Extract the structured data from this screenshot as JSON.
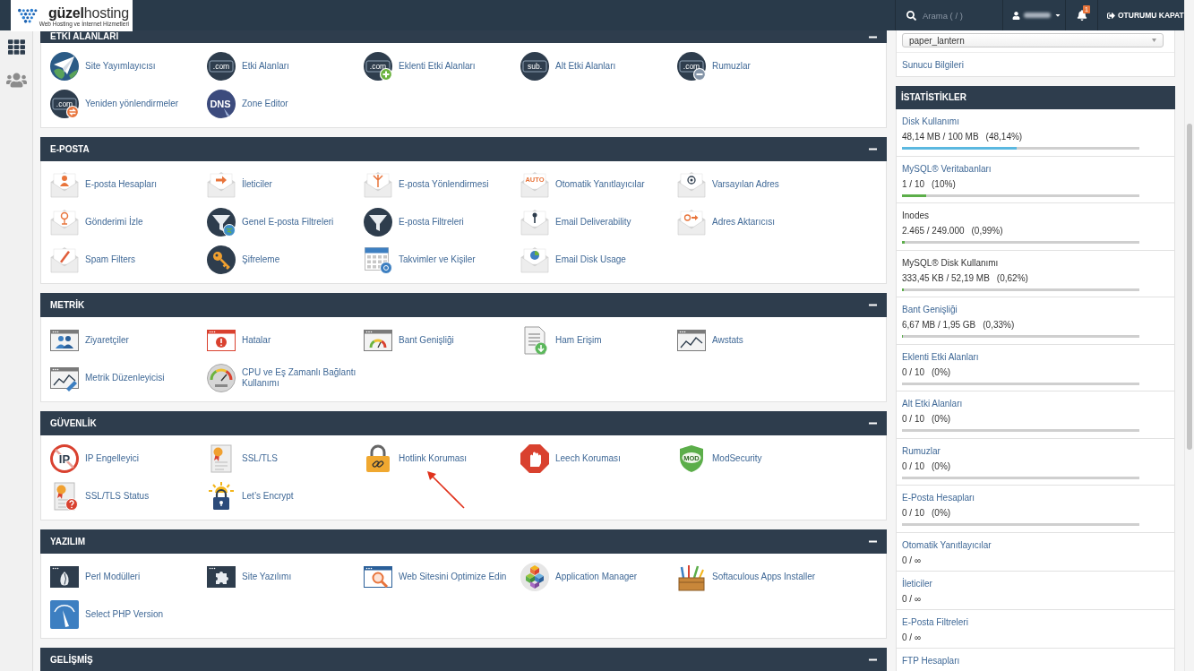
{
  "top_bar": {
    "logo": {
      "name": "**güzel**hosting",
      "tagline": "Web Hosting ve İnternet Hizmetleri"
    },
    "search": {
      "placeholder": "Arama ( / )"
    },
    "notifications": {
      "count": "1"
    },
    "logout": "OTURUMU KAPAT"
  },
  "sidebar": {
    "items": [
      {
        "selected": true
      },
      {
        "selected": false
      }
    ]
  },
  "sections": [
    {
      "title": "ETKİ ALANLARI",
      "expanded": true,
      "items": [
        {
          "label": "Site Yayımlayıcısı"
        },
        {
          "label": "Etki Alanları",
          "icon_text": ".com"
        },
        {
          "label": "Eklenti Etki Alanları",
          "icon_text": ".com"
        },
        {
          "label": "Alt Etki Alanları",
          "icon_text": "sub."
        },
        {
          "label": "Rumuzlar",
          "icon_text": ".com"
        },
        {
          "label": "Yeniden yönlendirmeler",
          "icon_text": ".com"
        },
        {
          "label": "Zone Editor",
          "icon_text": "DNS"
        }
      ]
    },
    {
      "title": "E-POSTA",
      "expanded": true,
      "items": [
        {
          "label": "E-posta Hesapları"
        },
        {
          "label": "İleticiler"
        },
        {
          "label": "E-posta Yönlendirmesi"
        },
        {
          "label": "Otomatik Yanıtlayıcılar",
          "icon_text": "AUTO"
        },
        {
          "label": "Varsayılan Adres"
        },
        {
          "label": "Gönderimi İzle"
        },
        {
          "label": "Genel E-posta Filtreleri"
        },
        {
          "label": "E-posta Filtreleri"
        },
        {
          "label": "Email Deliverability"
        },
        {
          "label": "Adres Aktarıcısı"
        },
        {
          "label": "Spam Filters"
        },
        {
          "label": "Şifreleme"
        },
        {
          "label": "Takvimler ve Kişiler"
        },
        {
          "label": "Email Disk Usage"
        }
      ]
    },
    {
      "title": "METRİK",
      "expanded": true,
      "items": [
        {
          "label": "Ziyaretçiler"
        },
        {
          "label": "Hatalar"
        },
        {
          "label": "Bant Genişliği"
        },
        {
          "label": "Ham Erişim"
        },
        {
          "label": "Awstats"
        },
        {
          "label": "Metrik Düzenleyicisi"
        },
        {
          "label": "CPU ve Eş Zamanlı Bağlantı Kullanımı"
        }
      ]
    },
    {
      "title": "GÜVENLİK",
      "expanded": true,
      "items": [
        {
          "label": "IP Engelleyici",
          "icon_text": "IP",
          "arrow": false
        },
        {
          "label": "SSL/TLS",
          "arrow": false
        },
        {
          "label": "Hotlink Koruması",
          "arrow": true
        },
        {
          "label": "Leech Koruması",
          "arrow": false
        },
        {
          "label": "ModSecurity",
          "icon_text": "MOD",
          "arrow": false
        },
        {
          "label": "SSL/TLS Status",
          "arrow": false
        },
        {
          "label": "Let’s Encrypt",
          "arrow": false
        }
      ]
    },
    {
      "title": "YAZILIM",
      "expanded": true,
      "items": [
        {
          "label": "Perl Modülleri"
        },
        {
          "label": "Site Yazılımı"
        },
        {
          "label": "Web Sitesini Optimize Edin"
        },
        {
          "label": "Application Manager"
        },
        {
          "label": "Softaculous Apps Installer"
        },
        {
          "label": "Select PHP Version"
        }
      ]
    },
    {
      "title": "GELİŞMİŞ",
      "expanded": true
    }
  ],
  "theme_select": {
    "value": "paper_lantern"
  },
  "server_info_link": "Sunucu Bilgileri",
  "statistics": {
    "title": "İSTATİSTİKLER",
    "rows": [
      {
        "kind": "bar",
        "label": "Disk Kullanımı",
        "link": true,
        "usage": "48,14 MB / 100 MB",
        "percent": "(48,14%)",
        "level": 0.4814,
        "color": "#5bb8e0"
      },
      {
        "kind": "bar",
        "label": "MySQL® Veritabanları",
        "link": true,
        "usage": "1 / 10",
        "percent": "(10%)",
        "level": 0.1,
        "color": "#5cae4a"
      },
      {
        "kind": "bar",
        "label": "Inodes",
        "link": false,
        "usage": "2.465 / 249.000",
        "percent": "(0,99%)",
        "level": 0.0099,
        "color": "#5cae4a"
      },
      {
        "kind": "bar",
        "label": "MySQL® Disk Kullanımı",
        "link": false,
        "usage": "333,45 KB / 52,19 MB",
        "percent": "(0,62%)",
        "level": 0.0062,
        "color": "#5cae4a"
      },
      {
        "kind": "bar",
        "label": "Bant Genişliği",
        "link": true,
        "usage": "6,67 MB / 1,95 GB",
        "percent": "(0,33%)",
        "level": 0.0033,
        "color": "#5cae4a"
      },
      {
        "kind": "bar",
        "label": "Eklenti Etki Alanları",
        "link": true,
        "usage": "0 / 10",
        "percent": "(0%)"
      },
      {
        "kind": "bar",
        "label": "Alt Etki Alanları",
        "link": true,
        "usage": "0 / 10",
        "percent": "(0%)"
      },
      {
        "kind": "bar",
        "label": "Rumuzlar",
        "link": true,
        "usage": "0 / 10",
        "percent": "(0%)"
      },
      {
        "kind": "bar",
        "label": "E-Posta Hesapları",
        "link": true,
        "usage": "0 / 10",
        "percent": "(0%)"
      },
      {
        "kind": "count",
        "label": "Otomatik Yanıtlayıcılar",
        "link": true,
        "usage": "0 / ∞"
      },
      {
        "kind": "count",
        "label": "İleticiler",
        "link": true,
        "usage": "0 / ∞"
      },
      {
        "kind": "count",
        "label": "E-Posta Filtreleri",
        "link": true,
        "usage": "0 / ∞"
      },
      {
        "label": "FTP Hesapları",
        "link": true
      }
    ]
  }
}
